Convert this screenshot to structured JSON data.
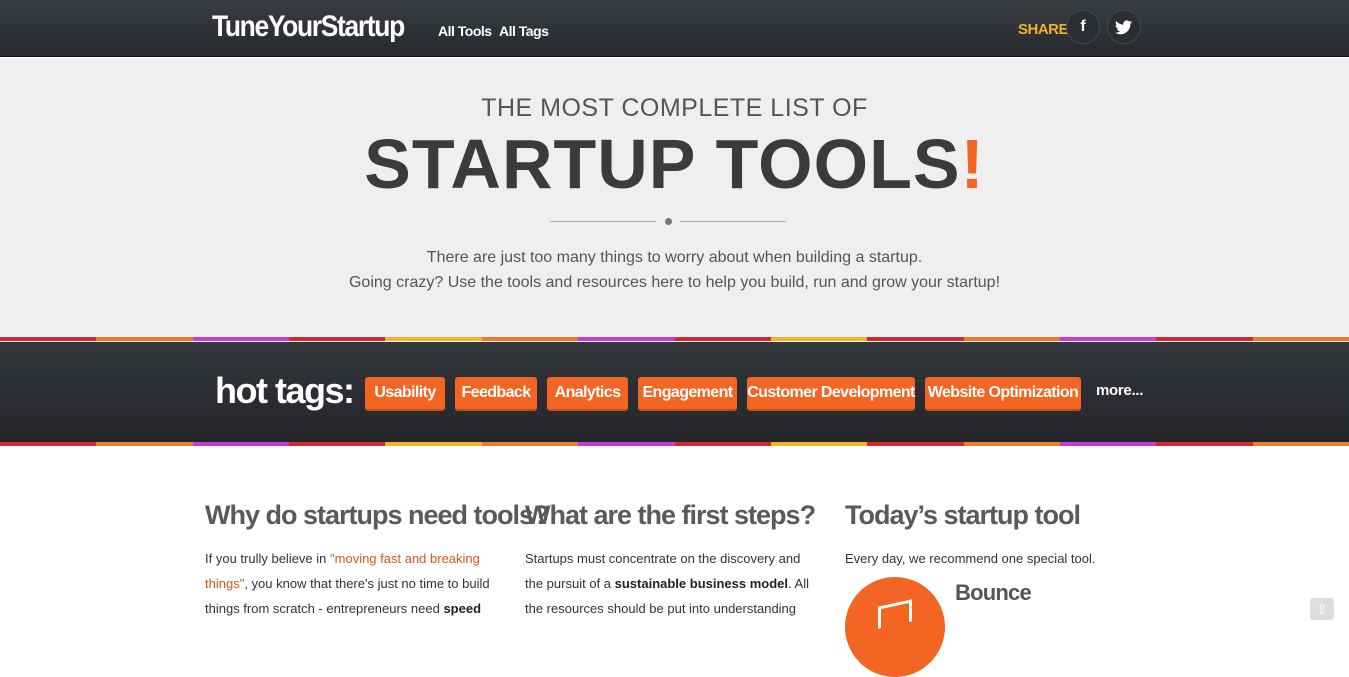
{
  "header": {
    "brand": "TuneYourStartup",
    "nav": [
      "All Tools",
      "All Tags"
    ],
    "share_label": "SHARE",
    "social_icons": [
      "facebook-icon",
      "twitter-icon"
    ],
    "facebook_glyph": "f",
    "twitter_glyph": "🐦"
  },
  "hero": {
    "kicker": "THE MOST COMPLETE LIST OF",
    "title": "STARTUP TOOLS",
    "title_accent": "!",
    "line1": "There are just too many things to worry about when building a startup.",
    "line2": "Going crazy? Use the tools and resources here to help you build, run and grow your startup!"
  },
  "hot_tags": {
    "label": "hot tags:",
    "tags": [
      "Usability",
      "Feedback",
      "Analytics",
      "Engagement",
      "Customer Development",
      "Website Optimization"
    ],
    "more": "more..."
  },
  "columns": [
    {
      "title": "Why do startups need tools?",
      "p1": "If you trully believe in ",
      "link": "\"moving fast and breaking things\"",
      "p2": ", you know that there's just no time to build things from scratch - entrepreneurs need ",
      "bold": "speed"
    },
    {
      "title": "What are the first steps?",
      "p1": "Startups must concentrate on the discovery and the pursuit of a ",
      "bold": "sustainable business model",
      "p2": ". All the resources should be put into understanding"
    },
    {
      "title": "Today’s startup tool",
      "p1": "Every day, we recommend one special tool.",
      "tool_name": "Bounce"
    }
  ],
  "colors": {
    "accent": "#f26522",
    "share": "#f0b428",
    "stripe": [
      "#d6262f",
      "#f07a28",
      "#c93bd6",
      "#d6262f",
      "#f0b428",
      "#f07a28",
      "#c93bd6",
      "#d6262f",
      "#f0b428",
      "#d6262f",
      "#f07a28",
      "#c93bd6",
      "#d6262f",
      "#f07a28"
    ]
  }
}
